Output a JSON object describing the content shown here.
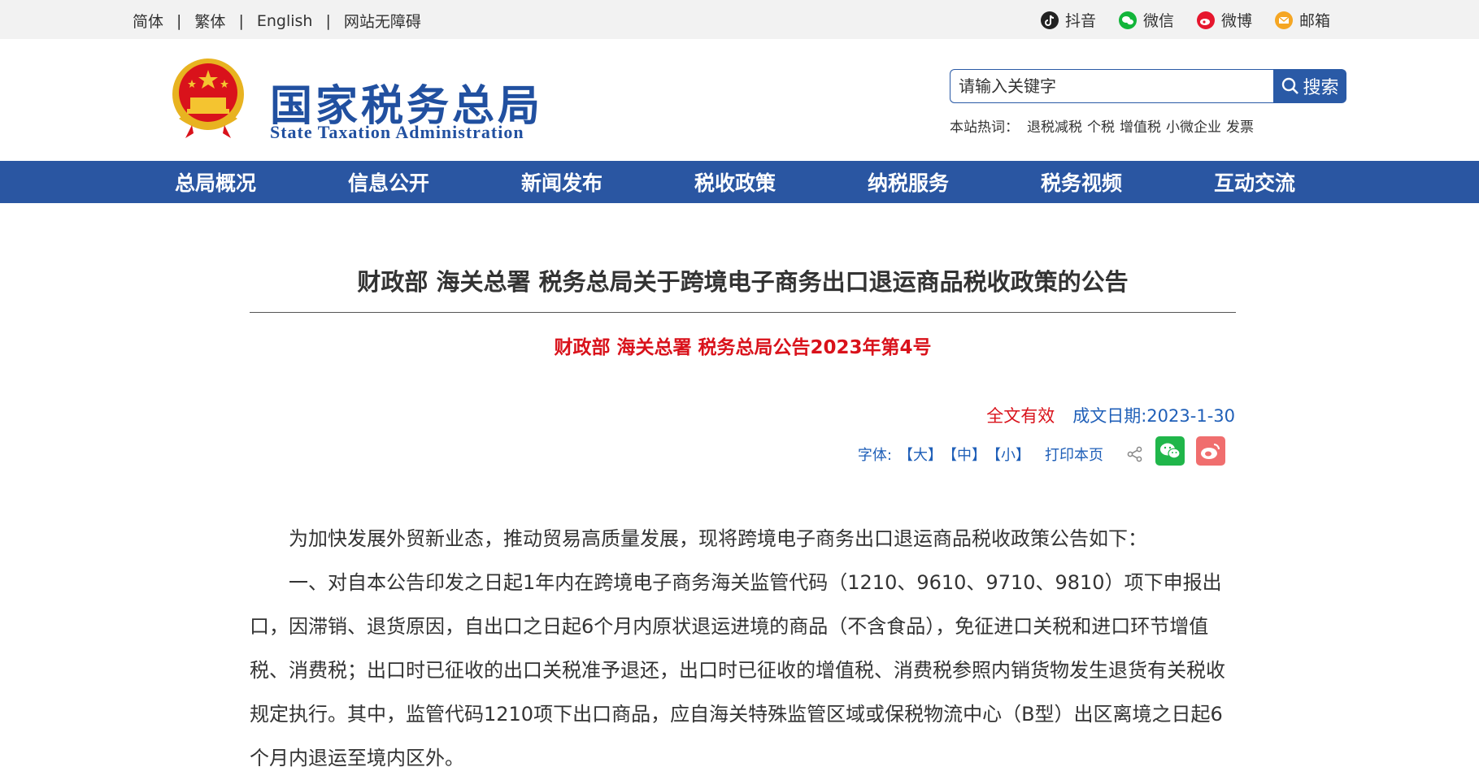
{
  "topbar": {
    "links": [
      "简体",
      "繁体",
      "English",
      "网站无障碍"
    ],
    "social": [
      {
        "label": "抖音",
        "icon": "douyin-icon"
      },
      {
        "label": "微信",
        "icon": "wechat-icon"
      },
      {
        "label": "微博",
        "icon": "weibo-icon"
      },
      {
        "label": "邮箱",
        "icon": "mail-icon"
      }
    ]
  },
  "header": {
    "logo_cn": "国家税务总局",
    "logo_en": "State Taxation Administration",
    "search": {
      "placeholder": "请输入关键字",
      "button_label": "搜索"
    },
    "hotwords_label": "本站热词：",
    "hotwords": [
      "退税减税",
      "个税",
      "增值税",
      "小微企业",
      "发票"
    ]
  },
  "nav": {
    "items": [
      "总局概况",
      "信息公开",
      "新闻发布",
      "税收政策",
      "纳税服务",
      "税务视频",
      "互动交流"
    ]
  },
  "article": {
    "title": "财政部 海关总署 税务总局关于跨境电子商务出口退运商品税收政策的公告",
    "doc_number": "财政部 海关总署 税务总局公告2023年第4号",
    "status": "全文有效",
    "date": "成文日期:2023-1-30",
    "tools": {
      "font_label": "字体:",
      "large": "【大】",
      "medium": "【中】",
      "small": "【小】",
      "print": "打印本页"
    },
    "paragraphs": [
      "为加快发展外贸新业态，推动贸易高质量发展，现将跨境电子商务出口退运商品税收政策公告如下：",
      "一、对自本公告印发之日起1年内在跨境电子商务海关监管代码（1210、9610、9710、9810）项下申报出口，因滞销、退货原因，自出口之日起6个月内原状退运进境的商品（不含食品），免征进口关税和进口环节增值税、消费税；出口时已征收的出口关税准予退还，出口时已征收的增值税、消费税参照内销货物发生退货有关税收规定执行。其中，监管代码1210项下出口商品，应自海关特殊监管区域或保税物流中心（B型）出区离境之日起6个月内退运至境内区外。"
    ]
  },
  "colors": {
    "brand_blue": "#2a56a2",
    "alert_red": "#d9121b",
    "link_blue": "#1f5fb8",
    "topbar_bg": "#f2f2f2"
  }
}
